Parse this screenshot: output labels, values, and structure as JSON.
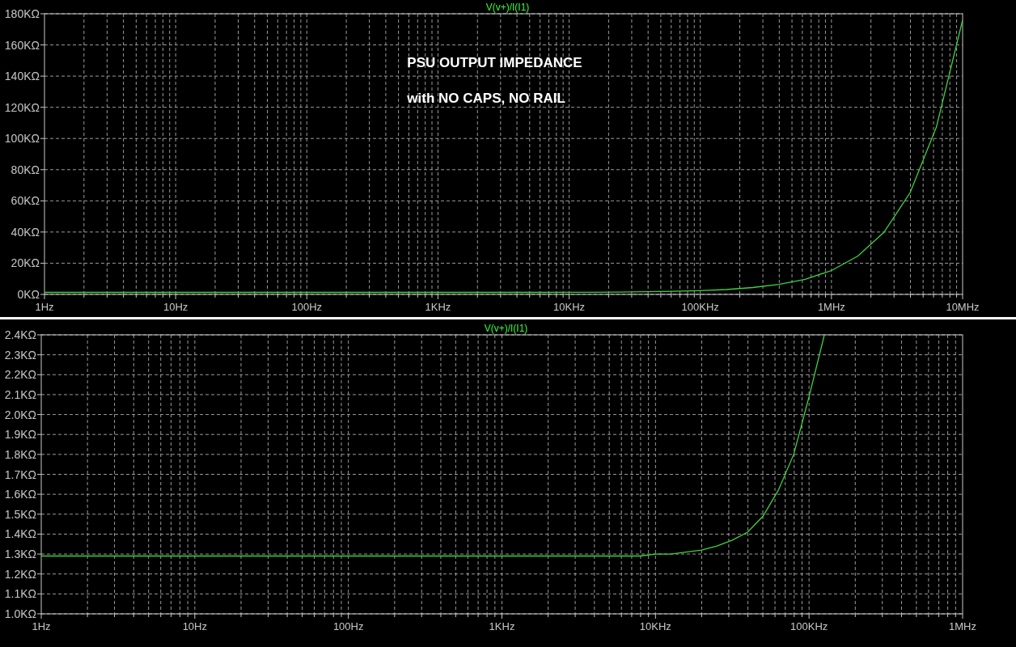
{
  "panes": [
    {
      "chart_data": {
        "type": "line",
        "grid": true,
        "categories": [
          "1Hz",
          null,
          null,
          null,
          null,
          "10Hz",
          null,
          null,
          null,
          null,
          "100Hz",
          null,
          null,
          null,
          null,
          "1KHz",
          null,
          null,
          null,
          null,
          "10KHz",
          null,
          null,
          null,
          null,
          "100KHz",
          null,
          null,
          null,
          null,
          "1MHz",
          null,
          null,
          null,
          null,
          "10MHz"
        ],
        "ylim": [
          0,
          180000
        ],
        "series": [
          {
            "name": "V(v+)/I(I1)",
            "color": "#3fd23f",
            "values": [
              1300,
              1300,
              1300,
              1300,
              1300,
              1300,
              1300,
              1300,
              1300,
              1300,
              1300,
              1300,
              1300,
              1300,
              1300,
              1300,
              1300,
              1300,
              1300,
              1300,
              1400,
              1400,
              1500,
              1700,
              2000,
              2400,
              3100,
              4400,
              6400,
              9700,
              15300,
              24500,
              39800,
              65200,
              107300,
              176000
            ]
          }
        ],
        "yticks": [
          {
            "value": 0,
            "label": "0KΩ"
          },
          {
            "value": 20000,
            "label": "20KΩ"
          },
          {
            "value": 40000,
            "label": "40KΩ"
          },
          {
            "value": 60000,
            "label": "60KΩ"
          },
          {
            "value": 80000,
            "label": "80KΩ"
          },
          {
            "value": 100000,
            "label": "100KΩ"
          },
          {
            "value": 120000,
            "label": "120KΩ"
          },
          {
            "value": 140000,
            "label": "140KΩ"
          },
          {
            "value": 160000,
            "label": "160KΩ"
          },
          {
            "value": 180000,
            "label": "180KΩ"
          }
        ],
        "annotations": [
          "PSU OUTPUT IMPEDANCE",
          "with NO CAPS, NO RAIL"
        ]
      }
    },
    {
      "chart_data": {
        "type": "line",
        "grid": true,
        "categories": [
          "1Hz",
          null,
          null,
          null,
          null,
          null,
          null,
          null,
          null,
          null,
          "10Hz",
          null,
          null,
          null,
          null,
          null,
          null,
          null,
          null,
          null,
          "100Hz",
          null,
          null,
          null,
          null,
          null,
          null,
          null,
          null,
          null,
          "1KHz",
          null,
          null,
          null,
          null,
          null,
          null,
          null,
          null,
          null,
          "10KHz",
          null,
          null,
          null,
          null,
          null,
          null,
          null,
          null,
          null,
          "100KHz",
          null,
          null,
          null,
          null,
          null,
          null,
          null,
          null,
          null,
          "1MHz"
        ],
        "ylim": [
          1000,
          2400
        ],
        "series": [
          {
            "name": "V(v+)/I(I1)",
            "color": "#3fd23f",
            "values": [
              1290,
              1290,
              1290,
              1290,
              1290,
              1290,
              1290,
              1290,
              1290,
              1290,
              1290,
              1290,
              1290,
              1290,
              1290,
              1290,
              1290,
              1290,
              1290,
              1290,
              1290,
              1290,
              1290,
              1290,
              1290,
              1290,
              1290,
              1290,
              1290,
              1290,
              1290,
              1290,
              1290,
              1290,
              1290,
              1290,
              1290,
              1290,
              1290,
              1290,
              1300,
              1300,
              1310,
              1320,
              1340,
              1370,
              1410,
              1490,
              1620,
              1800,
              2090,
              2400,
              null,
              null,
              null,
              null,
              null,
              null,
              null,
              null,
              null
            ]
          }
        ],
        "yticks": [
          {
            "value": 1000,
            "label": "1.0KΩ"
          },
          {
            "value": 1100,
            "label": "1.1KΩ"
          },
          {
            "value": 1200,
            "label": "1.2KΩ"
          },
          {
            "value": 1300,
            "label": "1.3KΩ"
          },
          {
            "value": 1400,
            "label": "1.4KΩ"
          },
          {
            "value": 1500,
            "label": "1.5KΩ"
          },
          {
            "value": 1600,
            "label": "1.6KΩ"
          },
          {
            "value": 1700,
            "label": "1.7KΩ"
          },
          {
            "value": 1800,
            "label": "1.8KΩ"
          },
          {
            "value": 1900,
            "label": "1.9KΩ"
          },
          {
            "value": 2000,
            "label": "2.0KΩ"
          },
          {
            "value": 2100,
            "label": "2.1KΩ"
          },
          {
            "value": 2200,
            "label": "2.2KΩ"
          },
          {
            "value": 2300,
            "label": "2.3KΩ"
          },
          {
            "value": 2400,
            "label": "2.4KΩ"
          }
        ]
      }
    }
  ]
}
